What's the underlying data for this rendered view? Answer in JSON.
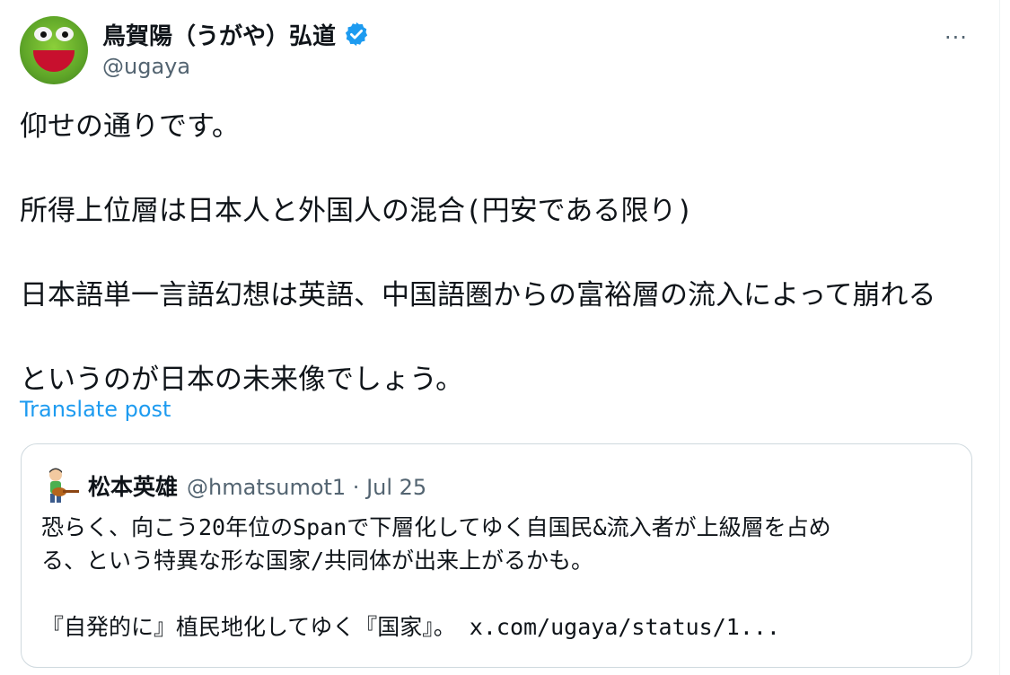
{
  "author": {
    "display_name": "鳥賀陽（うがや）弘道",
    "handle": "@ugaya",
    "avatar_icon": "kermit-frog-avatar-icon",
    "verified_icon": "verified-badge-icon"
  },
  "more_label": "···",
  "post": {
    "lines": [
      "仰せの通りです。",
      "",
      "所得上位層は日本人と外国人の混合(円安である限り)",
      "",
      "日本語単一言語幻想は英語、中国語圏からの富裕層の流入によって崩れる",
      "",
      "というのが日本の未来像でしょう。"
    ],
    "translate_label": "Translate post"
  },
  "quote": {
    "display_name": "松本英雄",
    "meta": "@hmatsumot1 · Jul 25",
    "avatar_icon": "guitar-player-avatar-icon",
    "lines": [
      "恐らく、向こう20年位のSpanで下層化してゆく自国民&流入者が上級層を占め",
      "る、という特異な形な国家/共同体が出来上がるかも。",
      "",
      "『自発的に』植民地化してゆく『国家』。 x.com/ugaya/status/1..."
    ]
  },
  "colors": {
    "accent": "#1d9bf0",
    "secondary_text": "#536471",
    "border": "#cfd9de"
  }
}
